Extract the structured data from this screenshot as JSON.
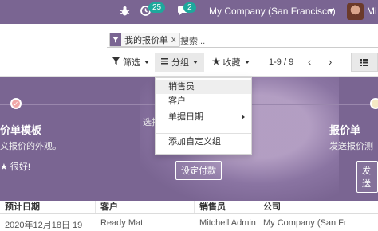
{
  "topbar": {
    "bug_icon": "bug-icon",
    "activity_icon": "clock-icon",
    "activity_count": "25",
    "chat_icon": "chat-icon",
    "chat_count": "2",
    "company": "My Company (San Francisco)",
    "user_truncated": "Mi"
  },
  "search": {
    "facet_label": "我的报价单",
    "facet_remove": "x",
    "placeholder": "搜索..."
  },
  "controls": {
    "filters_label": "筛选",
    "group_label": "分组",
    "favorites_label": "收藏",
    "pager": "1-9 / 9",
    "prev": "‹",
    "next": "›"
  },
  "group_menu": {
    "items": [
      "销售员",
      "客户",
      "单据日期"
    ],
    "custom": "添加自定义组"
  },
  "banner": {
    "left_title": "价单模板",
    "left_sub": "义报价的外观。",
    "left_good": "★ 很好!",
    "mid_sub": "选抄",
    "mid_button": "设定付款",
    "right_title": "报价单",
    "right_sub": "发送报价测",
    "right_button": "发送"
  },
  "table": {
    "headers": [
      "预计日期",
      "客户",
      "销售员",
      "公司"
    ],
    "row": [
      "2020年12月18日 19",
      "Ready Mat",
      "Mitchell Admin",
      "My Company (San Fr"
    ]
  },
  "colors": {
    "brand": "#7a6592",
    "badge": "#1ea89c",
    "step_dot": "#f0a8a8"
  }
}
